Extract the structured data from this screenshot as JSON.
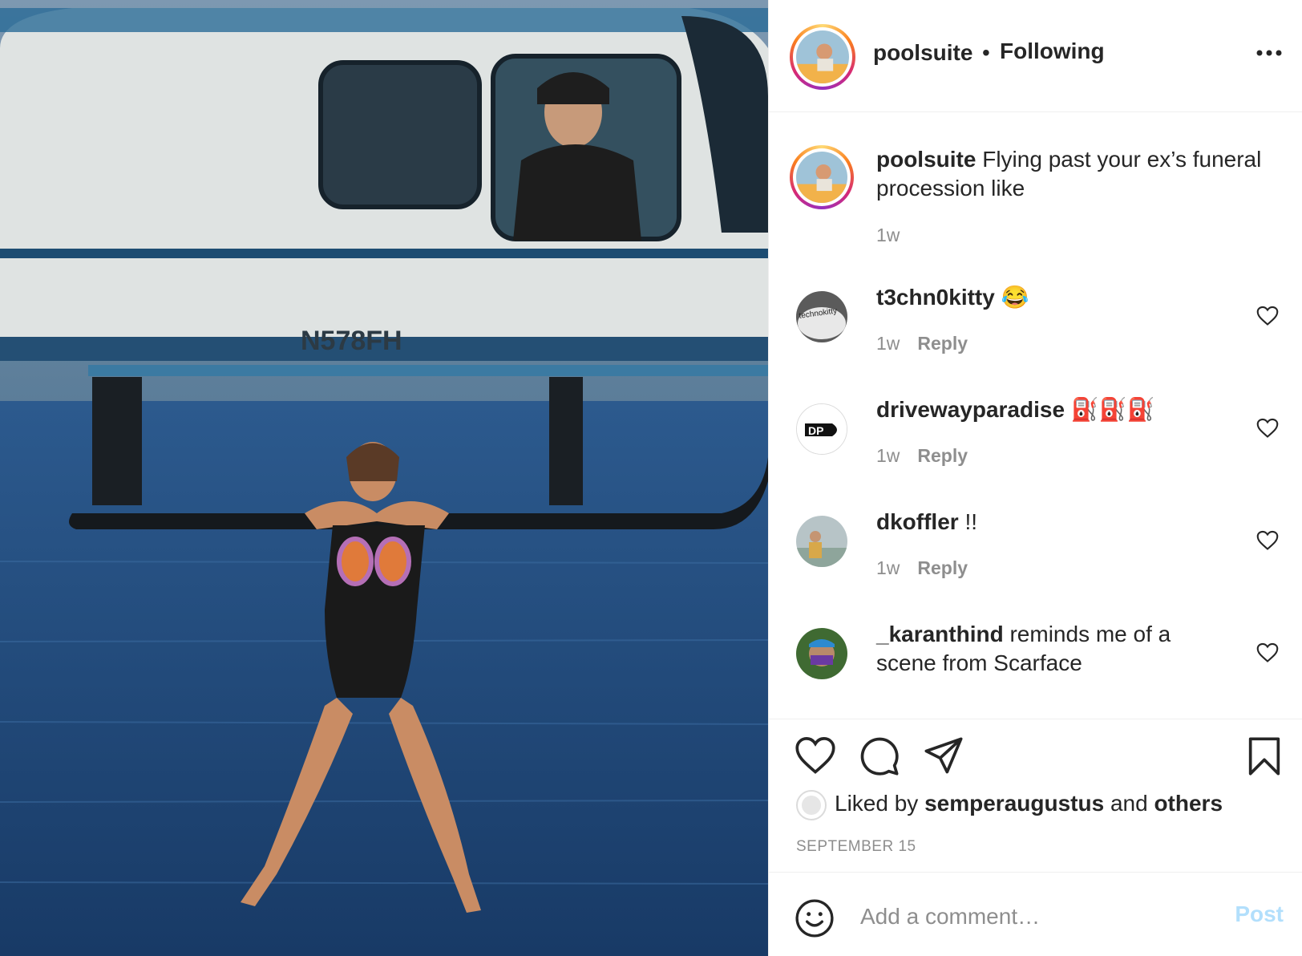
{
  "post": {
    "image_alt": "Woman in black swimsuit hanging from the skid of a white helicopter over the ocean",
    "registration": "N578FH"
  },
  "header": {
    "username": "poolsuite",
    "separator": "•",
    "follow_status": "Following"
  },
  "caption": {
    "username": "poolsuite",
    "text": "Flying past your ex’s funeral procession like",
    "time": "1w"
  },
  "comments": [
    {
      "username": "t3chn0kitty",
      "text": "😂",
      "time": "1w",
      "reply_label": "Reply",
      "avatar_text": "technokitty"
    },
    {
      "username": "drivewayparadise",
      "text": "⛽⛽⛽",
      "time": "1w",
      "reply_label": "Reply",
      "avatar_text": "DP"
    },
    {
      "username": "dkoffler",
      "text": "!!",
      "time": "1w",
      "reply_label": "Reply"
    },
    {
      "username": "_karanthind",
      "text": "reminds me of a scene from Scarface"
    }
  ],
  "likes": {
    "prefix": "Liked by",
    "user": "semperaugustus",
    "middle": "and",
    "others": "others"
  },
  "date": "SEPTEMBER 15",
  "add_comment": {
    "placeholder": "Add a comment…",
    "post_label": "Post"
  },
  "colors": {
    "post_button_disabled": "#b2dffc",
    "meta_gray": "#8e8e8e",
    "text": "#262626"
  }
}
